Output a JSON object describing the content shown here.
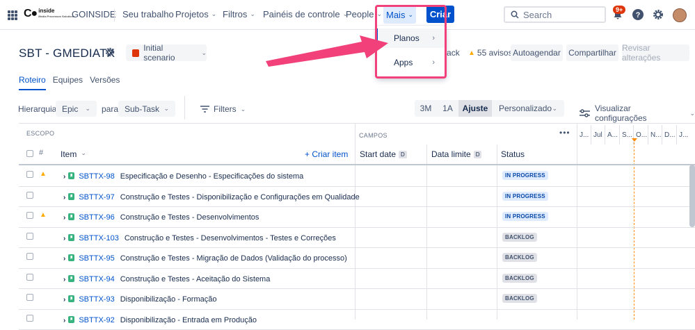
{
  "nav": {
    "logo_text": "inside",
    "logo_sub": "Media Processos Solutions",
    "org": "GOINSIDE",
    "items": [
      "Seu trabalho",
      "Projetos",
      "Filtros",
      "Painéis de controle",
      "People"
    ],
    "mais": "Mais",
    "criar": "Criar",
    "search_placeholder": "Search",
    "notif_badge": "9+"
  },
  "dropdown": {
    "items": [
      {
        "label": "Planos"
      },
      {
        "label": "Apps"
      }
    ]
  },
  "header": {
    "title": "SBT - GMEDIATX",
    "scenario": "Initial scenario",
    "feedback": "edback",
    "warnings": "55 avisos",
    "autoagendar": "Autoagendar",
    "compartilhar": "Compartilhar",
    "revisar": "Revisar alterações"
  },
  "tabs": [
    "Roteiro",
    "Equipes",
    "Versões"
  ],
  "filters": {
    "hierarquia_label": "Hierarquia:",
    "from": "Epic",
    "para_label": "para",
    "to": "Sub-Task",
    "filters_label": "Filters",
    "ranges": [
      "3M",
      "1A",
      "Ajuste",
      "Personalizado"
    ],
    "view_settings": "Visualizar configurações"
  },
  "table": {
    "escopo": "ESCOPO",
    "campos": "CAMPOS",
    "hash": "#",
    "item": "Item",
    "criar_item": "+ Criar item",
    "start_date": "Start date",
    "data_limite": "Data limite",
    "d": "D",
    "status": "Status",
    "more": "•••",
    "timeline": [
      "J...",
      "Jul",
      "A...",
      "S...",
      "O...",
      "N...",
      "D...",
      "J..."
    ],
    "rows": [
      {
        "key": "SBTTX-98",
        "summary": "Especificação e Desenho - Especificações do sistema",
        "status": "IN PROGRESS",
        "warn": true
      },
      {
        "key": "SBTTX-97",
        "summary": "Construção e Testes - Disponibilização e Configurações em Qualidade",
        "status": "IN PROGRESS",
        "warn": false
      },
      {
        "key": "SBTTX-96",
        "summary": "Construção e Testes - Desenvolvimentos",
        "status": "IN PROGRESS",
        "warn": true
      },
      {
        "key": "SBTTX-103",
        "summary": "Construção e Testes - Desenvolvimentos - Testes e Correções",
        "status": "BACKLOG",
        "warn": false
      },
      {
        "key": "SBTTX-95",
        "summary": "Construção e Testes - Migração de Dados (Validação do processo)",
        "status": "BACKLOG",
        "warn": false
      },
      {
        "key": "SBTTX-94",
        "summary": "Construção e Testes - Aceitação do Sistema",
        "status": "BACKLOG",
        "warn": false
      },
      {
        "key": "SBTTX-93",
        "summary": "Disponibilização - Formação",
        "status": "BACKLOG",
        "warn": false
      },
      {
        "key": "SBTTX-92",
        "summary": "Disponibilização - Entrada em Produção",
        "status": "",
        "warn": false
      }
    ]
  },
  "colors": {
    "accent": "#0052CC",
    "highlight": "#F1407A",
    "arrow": "#F1407A"
  }
}
